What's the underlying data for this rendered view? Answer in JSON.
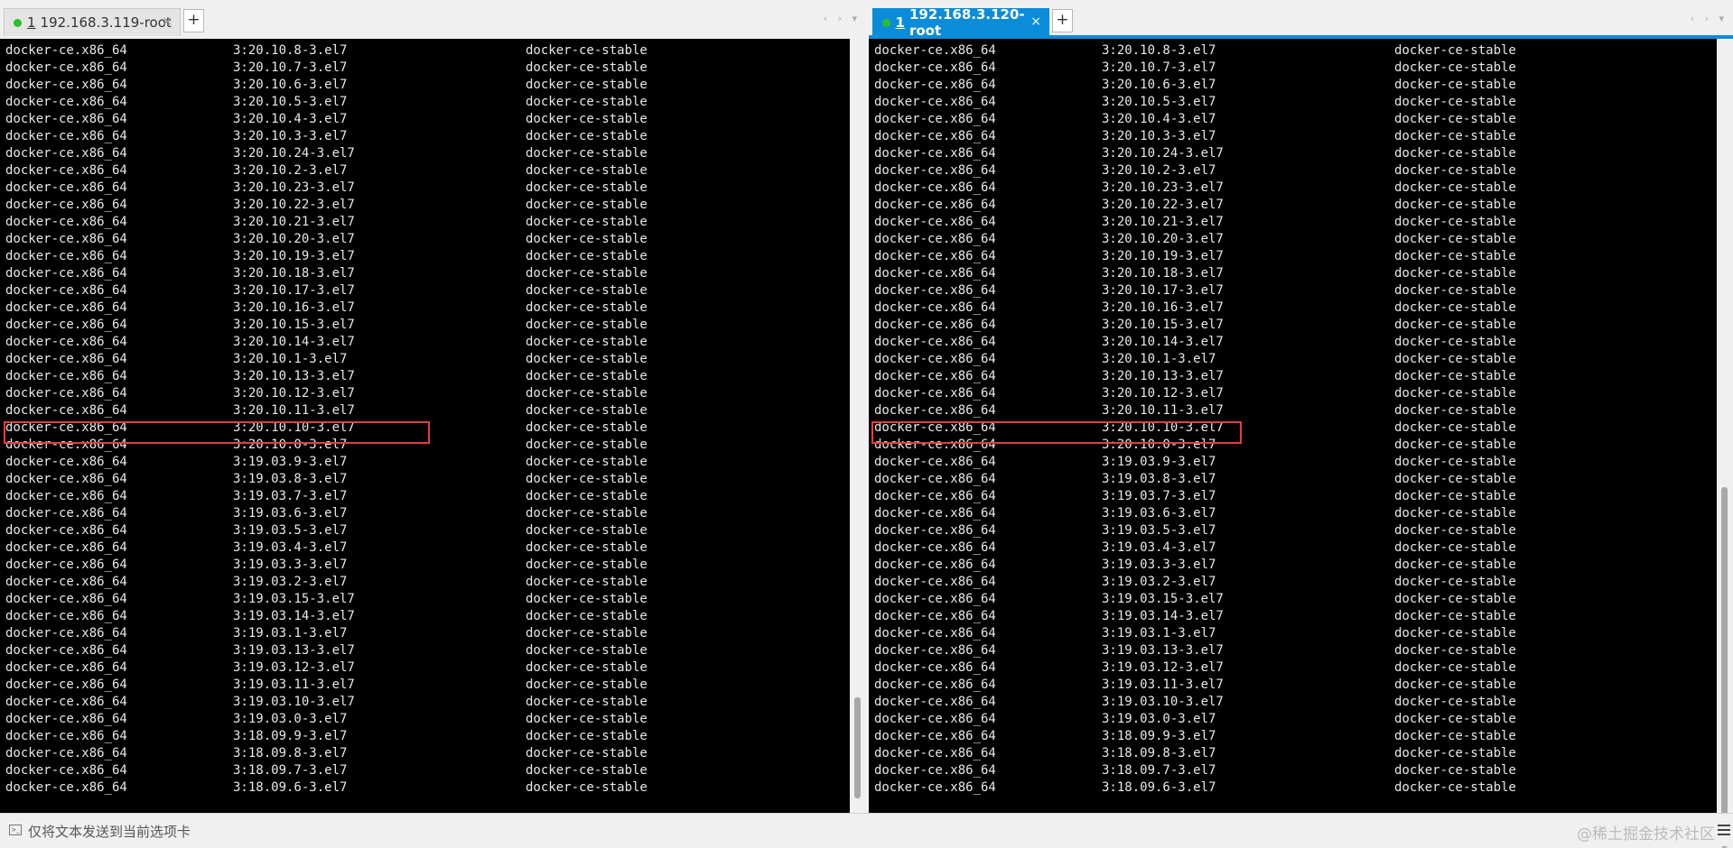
{
  "tabs": [
    {
      "num": "1",
      "title": "192.168.3.119-root",
      "close": "×"
    },
    {
      "num": "1",
      "title": "192.168.3.120-root",
      "close": "×"
    }
  ],
  "newtab": "+",
  "nav_arrows": "‹ › ▾",
  "rows": [
    [
      "docker-ce.x86_64",
      "3:20.10.8-3.el7",
      "docker-ce-stable"
    ],
    [
      "docker-ce.x86_64",
      "3:20.10.7-3.el7",
      "docker-ce-stable"
    ],
    [
      "docker-ce.x86_64",
      "3:20.10.6-3.el7",
      "docker-ce-stable"
    ],
    [
      "docker-ce.x86_64",
      "3:20.10.5-3.el7",
      "docker-ce-stable"
    ],
    [
      "docker-ce.x86_64",
      "3:20.10.4-3.el7",
      "docker-ce-stable"
    ],
    [
      "docker-ce.x86_64",
      "3:20.10.3-3.el7",
      "docker-ce-stable"
    ],
    [
      "docker-ce.x86_64",
      "3:20.10.24-3.el7",
      "docker-ce-stable"
    ],
    [
      "docker-ce.x86_64",
      "3:20.10.2-3.el7",
      "docker-ce-stable"
    ],
    [
      "docker-ce.x86_64",
      "3:20.10.23-3.el7",
      "docker-ce-stable"
    ],
    [
      "docker-ce.x86_64",
      "3:20.10.22-3.el7",
      "docker-ce-stable"
    ],
    [
      "docker-ce.x86_64",
      "3:20.10.21-3.el7",
      "docker-ce-stable"
    ],
    [
      "docker-ce.x86_64",
      "3:20.10.20-3.el7",
      "docker-ce-stable"
    ],
    [
      "docker-ce.x86_64",
      "3:20.10.19-3.el7",
      "docker-ce-stable"
    ],
    [
      "docker-ce.x86_64",
      "3:20.10.18-3.el7",
      "docker-ce-stable"
    ],
    [
      "docker-ce.x86_64",
      "3:20.10.17-3.el7",
      "docker-ce-stable"
    ],
    [
      "docker-ce.x86_64",
      "3:20.10.16-3.el7",
      "docker-ce-stable"
    ],
    [
      "docker-ce.x86_64",
      "3:20.10.15-3.el7",
      "docker-ce-stable"
    ],
    [
      "docker-ce.x86_64",
      "3:20.10.14-3.el7",
      "docker-ce-stable"
    ],
    [
      "docker-ce.x86_64",
      "3:20.10.1-3.el7",
      "docker-ce-stable"
    ],
    [
      "docker-ce.x86_64",
      "3:20.10.13-3.el7",
      "docker-ce-stable"
    ],
    [
      "docker-ce.x86_64",
      "3:20.10.12-3.el7",
      "docker-ce-stable"
    ],
    [
      "docker-ce.x86_64",
      "3:20.10.11-3.el7",
      "docker-ce-stable"
    ],
    [
      "docker-ce.x86_64",
      "3:20.10.10-3.el7",
      "docker-ce-stable"
    ],
    [
      "docker-ce.x86_64",
      "3:20.10.0-3.el7",
      "docker-ce-stable"
    ],
    [
      "docker-ce.x86_64",
      "3:19.03.9-3.el7",
      "docker-ce-stable"
    ],
    [
      "docker-ce.x86_64",
      "3:19.03.8-3.el7",
      "docker-ce-stable"
    ],
    [
      "docker-ce.x86_64",
      "3:19.03.7-3.el7",
      "docker-ce-stable"
    ],
    [
      "docker-ce.x86_64",
      "3:19.03.6-3.el7",
      "docker-ce-stable"
    ],
    [
      "docker-ce.x86_64",
      "3:19.03.5-3.el7",
      "docker-ce-stable"
    ],
    [
      "docker-ce.x86_64",
      "3:19.03.4-3.el7",
      "docker-ce-stable"
    ],
    [
      "docker-ce.x86_64",
      "3:19.03.3-3.el7",
      "docker-ce-stable"
    ],
    [
      "docker-ce.x86_64",
      "3:19.03.2-3.el7",
      "docker-ce-stable"
    ],
    [
      "docker-ce.x86_64",
      "3:19.03.15-3.el7",
      "docker-ce-stable"
    ],
    [
      "docker-ce.x86_64",
      "3:19.03.14-3.el7",
      "docker-ce-stable"
    ],
    [
      "docker-ce.x86_64",
      "3:19.03.1-3.el7",
      "docker-ce-stable"
    ],
    [
      "docker-ce.x86_64",
      "3:19.03.13-3.el7",
      "docker-ce-stable"
    ],
    [
      "docker-ce.x86_64",
      "3:19.03.12-3.el7",
      "docker-ce-stable"
    ],
    [
      "docker-ce.x86_64",
      "3:19.03.11-3.el7",
      "docker-ce-stable"
    ],
    [
      "docker-ce.x86_64",
      "3:19.03.10-3.el7",
      "docker-ce-stable"
    ],
    [
      "docker-ce.x86_64",
      "3:19.03.0-3.el7",
      "docker-ce-stable"
    ],
    [
      "docker-ce.x86_64",
      "3:18.09.9-3.el7",
      "docker-ce-stable"
    ],
    [
      "docker-ce.x86_64",
      "3:18.09.8-3.el7",
      "docker-ce-stable"
    ],
    [
      "docker-ce.x86_64",
      "3:18.09.7-3.el7",
      "docker-ce-stable"
    ],
    [
      "docker-ce.x86_64",
      "3:18.09.6-3.el7",
      "docker-ce-stable"
    ]
  ],
  "status": {
    "send_text": "仅将文本发送到当前选项卡",
    "watermark": "@稀土掘金技术社区"
  },
  "colors": {
    "accent": "#0a8cd9",
    "highlight": "#e0403c",
    "terminal_bg": "#000000",
    "terminal_fg": "#e8e8e8"
  },
  "icons": [
    "status-dot-icon",
    "new-tab-icon",
    "close-icon",
    "chevron-left-icon",
    "chevron-right-icon",
    "dropdown-icon",
    "terminal-icon",
    "menu-icon"
  ]
}
